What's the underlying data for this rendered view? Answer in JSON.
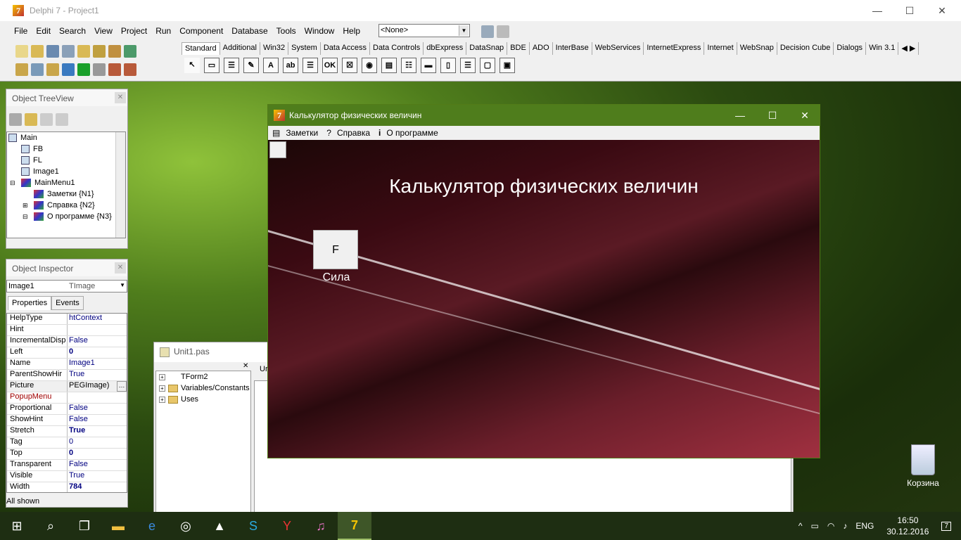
{
  "main": {
    "title": "Delphi 7 - Project1",
    "min": "—",
    "max": "☐",
    "close": "✕",
    "menu": [
      "File",
      "Edit",
      "Search",
      "View",
      "Project",
      "Run",
      "Component",
      "Database",
      "Tools",
      "Window",
      "Help"
    ],
    "combo_value": "<None>"
  },
  "palette": {
    "tabs": [
      "Standard",
      "Additional",
      "Win32",
      "System",
      "Data Access",
      "Data Controls",
      "dbExpress",
      "DataSnap",
      "BDE",
      "ADO",
      "InterBase",
      "WebServices",
      "InternetExpress",
      "Internet",
      "WebSnap",
      "Decision Cube",
      "Dialogs",
      "Win 3.1"
    ],
    "components": [
      "↖",
      "▭",
      "☰",
      "✎",
      "A",
      "ab",
      "☰",
      "OK",
      "☒",
      "◉",
      "▤",
      "☷",
      "▬",
      "▯",
      "☰",
      "▢",
      "▣"
    ]
  },
  "treeview": {
    "title": "Object TreeView",
    "items": [
      {
        "label": "Main",
        "indent": 0
      },
      {
        "label": "FB",
        "indent": 1
      },
      {
        "label": "FL",
        "indent": 1
      },
      {
        "label": "Image1",
        "indent": 1
      },
      {
        "label": "MainMenu1",
        "indent": 1
      },
      {
        "label": "Заметки {N1}",
        "indent": 2
      },
      {
        "label": "Справка {N2}",
        "indent": 2
      },
      {
        "label": "О программе {N3}",
        "indent": 2
      }
    ]
  },
  "inspector": {
    "title": "Object Inspector",
    "object": "Image1",
    "type": "TImage",
    "tabs": [
      "Properties",
      "Events"
    ],
    "props": [
      [
        "HelpType",
        "htContext"
      ],
      [
        "Hint",
        ""
      ],
      [
        "IncrementalDisp",
        "False"
      ],
      [
        "Left",
        "0"
      ],
      [
        "Name",
        "Image1"
      ],
      [
        "ParentShowHir",
        "True"
      ],
      [
        "Picture",
        "PEGImage)"
      ],
      [
        "PopupMenu",
        ""
      ],
      [
        "Proportional",
        "False"
      ],
      [
        "ShowHint",
        "False"
      ],
      [
        "Stretch",
        "True"
      ],
      [
        "Tag",
        "0"
      ],
      [
        "Top",
        "0"
      ],
      [
        "Transparent",
        "False"
      ],
      [
        "Visible",
        "True"
      ],
      [
        "Width",
        "784"
      ]
    ],
    "status": "All shown"
  },
  "editor": {
    "title": "Unit1.pas",
    "tab": "Ur",
    "nodes": [
      "TForm2",
      "Variables/Constants",
      "Uses"
    ]
  },
  "calc": {
    "title": "Калькулятор физических величин",
    "menu": [
      "Заметки",
      "Справка",
      "О программе"
    ],
    "heading": "Калькулятор физических величин",
    "button": "F",
    "button_label": "Сила"
  },
  "desktop": {
    "recycle": "Корзина"
  },
  "taskbar": {
    "lang": "ENG",
    "time": "16:50",
    "date": "30.12.2016",
    "notif": "7"
  }
}
